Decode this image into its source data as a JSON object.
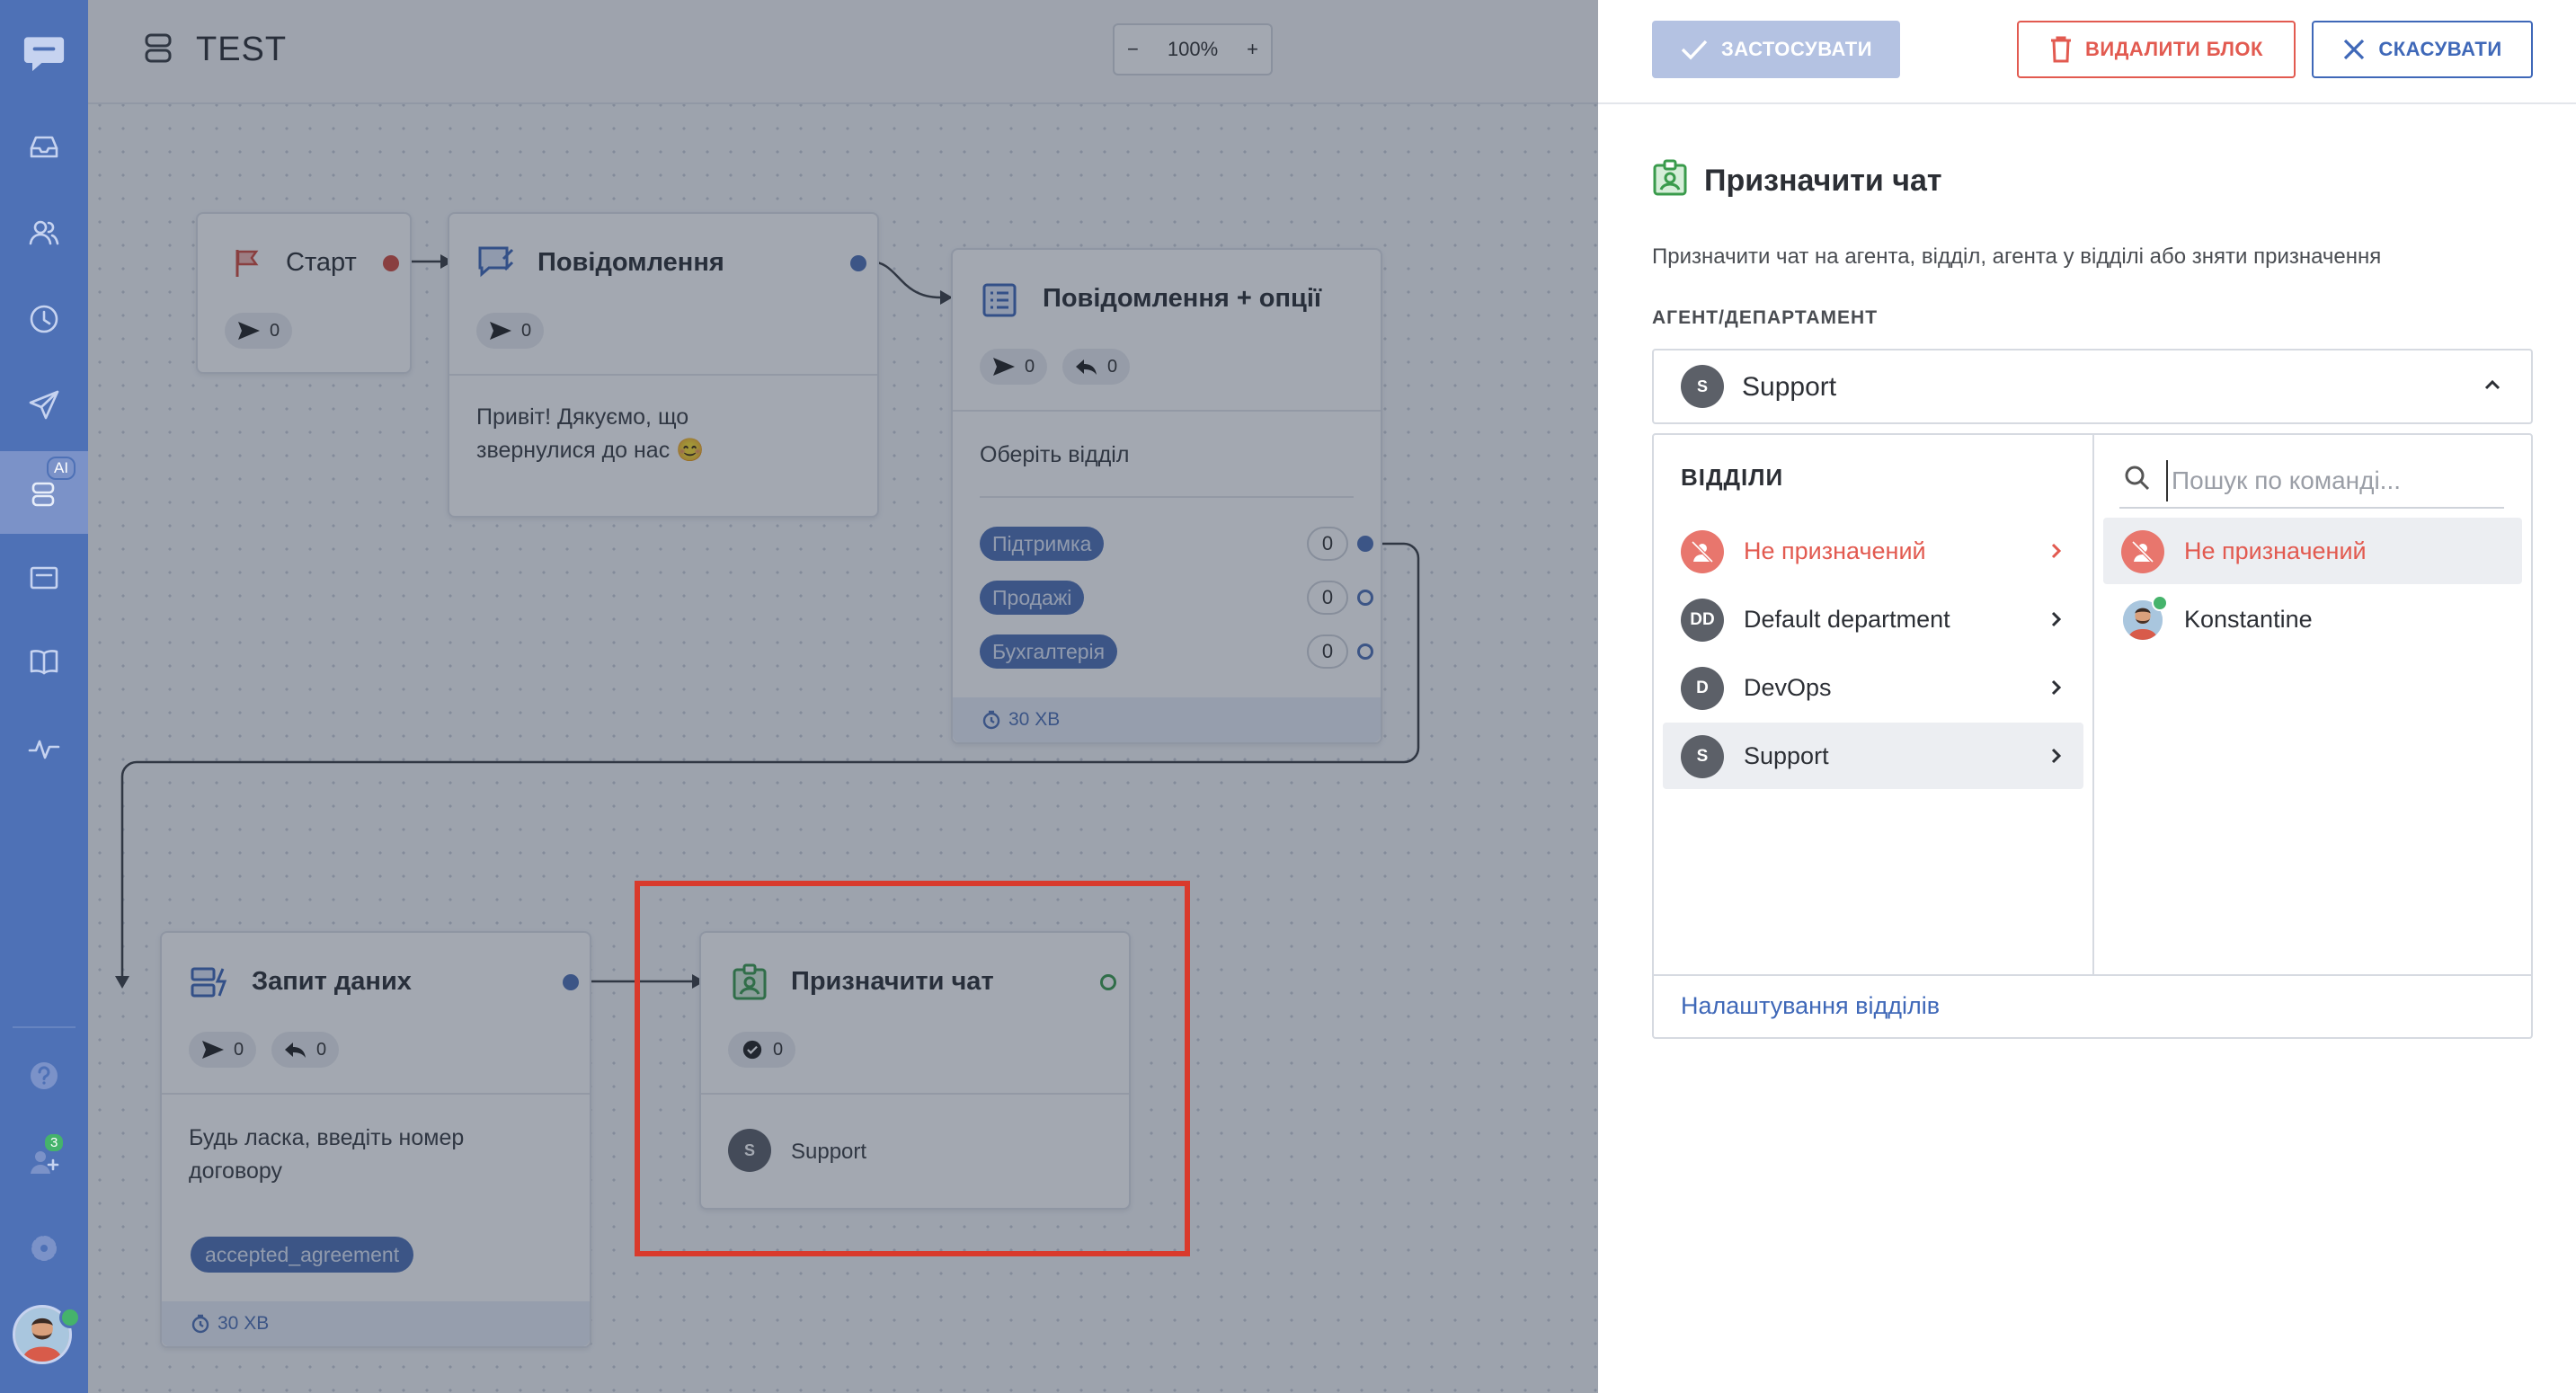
{
  "nav": {
    "ai_badge": "AI",
    "users_badge": "3"
  },
  "flow": {
    "title": "TEST",
    "zoom": "100%",
    "zoom_out": "−",
    "zoom_in": "+"
  },
  "nodes": {
    "start": {
      "title": "Старт",
      "sent": "0"
    },
    "message": {
      "title": "Повідомлення",
      "sent": "0",
      "text": "Привіт! Дякуємо, що звернулися до нас 😊"
    },
    "message_options": {
      "title": "Повідомлення + опції",
      "sent": "0",
      "replies": "0",
      "text": "Оберіть відділ",
      "options": [
        {
          "label": "Підтримка",
          "count": "0"
        },
        {
          "label": "Продажі",
          "count": "0"
        },
        {
          "label": "Бухгалтерія",
          "count": "0"
        }
      ],
      "timeout": "30 ХВ"
    },
    "data_request": {
      "title": "Запит даних",
      "sent": "0",
      "replies": "0",
      "text_line1": "Будь ласка, введіть номер",
      "text_line2": "договору",
      "tag": "accepted_agreement",
      "timeout": "30 ХВ"
    },
    "assign_chat": {
      "title": "Призначити чат",
      "done": "0",
      "assignee_avatar": "S",
      "assignee": "Support"
    }
  },
  "panel": {
    "apply_label": "ЗАСТОСУВАТИ",
    "delete_label": "ВИДАЛИТИ БЛОК",
    "cancel_label": "СКАСУВАТИ",
    "title": "Призначити чат",
    "description": "Призначити чат на агента, відділ, агента у відділі або зняти призначення",
    "field_label": "АГЕНТ/ДЕПАРТАМЕНТ",
    "selected_avatar": "S",
    "selected_value": "Support",
    "departments_header": "ВІДДІЛИ",
    "departments": [
      {
        "avatar": "",
        "label": "Не призначений"
      },
      {
        "avatar": "DD",
        "label": "Default department"
      },
      {
        "avatar": "D",
        "label": "DevOps"
      },
      {
        "avatar": "S",
        "label": "Support"
      }
    ],
    "search_placeholder": "Пошук по команді...",
    "agents": [
      {
        "label": "Не призначений"
      },
      {
        "label": "Konstantine"
      }
    ],
    "settings_link": "Налаштування відділів"
  },
  "colors": {
    "nav": "#4e71b6",
    "accent": "#3f68b8",
    "danger": "#e25a50",
    "highlight": "#d93a2c",
    "success": "#3a9b4c"
  }
}
